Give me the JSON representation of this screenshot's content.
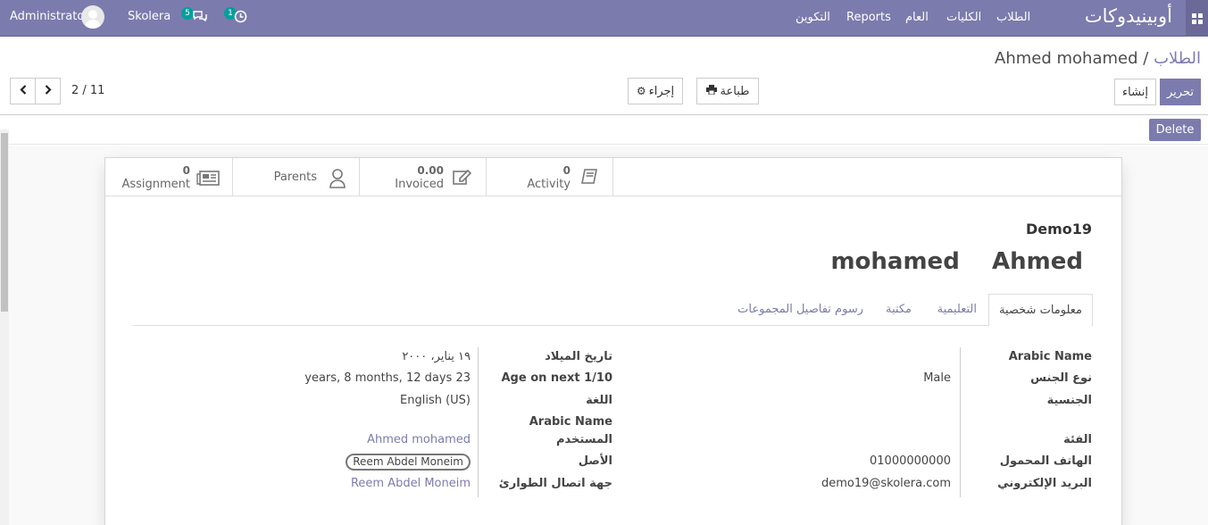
{
  "navbar": {
    "brand": "أوبينيدوكات",
    "menu": [
      "الطلاب",
      "الكليات",
      "العام",
      "Reports",
      "التكوين"
    ],
    "user": "Administrator",
    "company": "Skolera",
    "messages_count": "5",
    "activities_count": "1"
  },
  "breadcrumb": {
    "parent": "الطلاب",
    "separator": "/",
    "current": "Ahmed mohamed"
  },
  "control": {
    "edit": "تحرير",
    "create": "إنشاء",
    "print": "طباعة",
    "action": "إجراء",
    "pager": "2 / 11"
  },
  "statusbar": {
    "delete": "Delete"
  },
  "stats": {
    "activity": {
      "value": "0",
      "label": "Activity"
    },
    "invoiced": {
      "value": "0.00",
      "label": "Invoiced"
    },
    "parents": {
      "label": "Parents"
    },
    "assignment": {
      "value": "0",
      "label": "Assignment"
    }
  },
  "record": {
    "ref": "Demo19",
    "first_name": "Ahmed",
    "last_name": "mohamed"
  },
  "tabs": [
    "معلومات شخصية",
    "التعليمية",
    "مكتبة",
    "رسوم تفاصيل المجموعات"
  ],
  "fields_right": {
    "arabic_name": {
      "label": "Arabic Name",
      "value": ""
    },
    "gender": {
      "label": "نوع الجنس",
      "value": "Male"
    },
    "nationality": {
      "label": "الجنسية",
      "value": ""
    },
    "category": {
      "label": "الفئة",
      "value": ""
    },
    "mobile": {
      "label": "الهاتف المحمول",
      "value": "01000000000"
    },
    "email": {
      "label": "البريد الإلكتروني",
      "value": "demo19@skolera.com"
    }
  },
  "fields_left": {
    "birth_date": {
      "label": "تاريخ الميلاد",
      "value": "١٩ يناير، ٢٠٠٠"
    },
    "age": {
      "label": "Age on next 1/10",
      "value": "23 years, 8 months, 12 days"
    },
    "language": {
      "label": "اللغة",
      "value": "English (US)"
    },
    "arabic_name": {
      "label": "Arabic Name",
      "value": ""
    },
    "user": {
      "label": "المستخدم",
      "value": "Ahmed mohamed"
    },
    "origin": {
      "label": "الأصل",
      "value": "Reem Abdel Moneim"
    },
    "emergency": {
      "label": "جهة اتصال الطوارئ",
      "value": "Reem Abdel Moneim"
    }
  }
}
